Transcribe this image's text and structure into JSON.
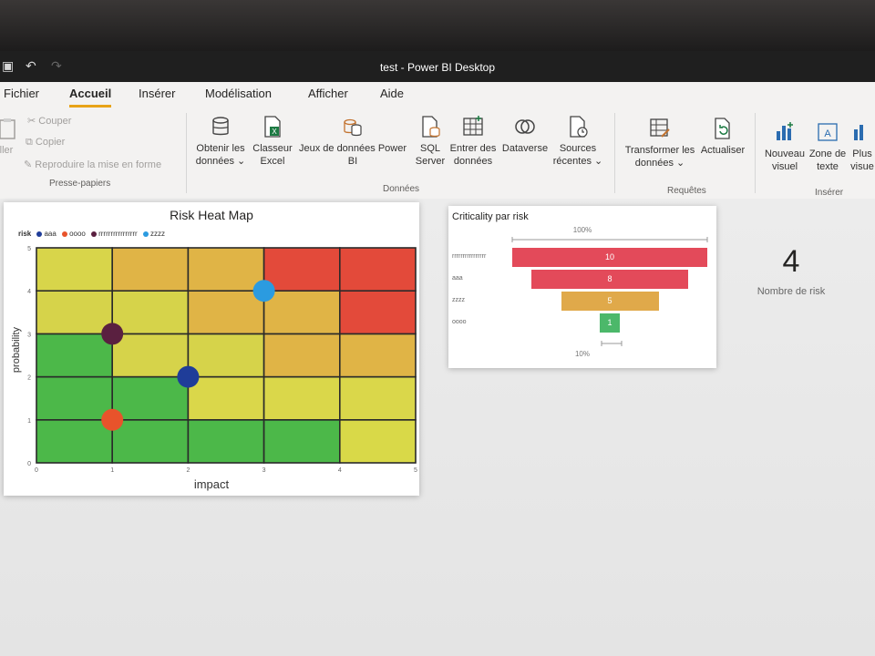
{
  "window": {
    "title": "test - Power BI Desktop",
    "save_icon": "save-icon",
    "undo_icon": "undo-icon",
    "redo_icon": "redo-icon"
  },
  "menu": {
    "items": [
      {
        "label": "Fichier"
      },
      {
        "label": "Accueil",
        "active": true
      },
      {
        "label": "Insérer"
      },
      {
        "label": "Modélisation"
      },
      {
        "label": "Afficher"
      },
      {
        "label": "Aide"
      }
    ]
  },
  "ribbon": {
    "clipboard": {
      "paste_label": "ller",
      "cut": "Couper",
      "copy": "Copier",
      "format_painter": "Reproduire la mise en forme",
      "group": "Presse-papiers"
    },
    "data": {
      "get_data": {
        "line1": "Obtenir les",
        "line2": "données"
      },
      "excel": {
        "line1": "Classeur",
        "line2": "Excel"
      },
      "datasets": {
        "line1": "Jeux de données Power",
        "line2": "BI"
      },
      "sql": {
        "line1": "SQL",
        "line2": "Server"
      },
      "enter_data": {
        "line1": "Entrer des",
        "line2": "données"
      },
      "dataverse": {
        "line1": "Dataverse"
      },
      "recent": {
        "line1": "Sources",
        "line2": "récentes"
      },
      "group": "Données"
    },
    "queries": {
      "transform": {
        "line1": "Transformer les",
        "line2": "données"
      },
      "refresh": {
        "line1": "Actualiser"
      },
      "group": "Requêtes"
    },
    "insert": {
      "new_visual": {
        "line1": "Nouveau",
        "line2": "visuel"
      },
      "text_box": {
        "line1": "Zone de",
        "line2": "texte"
      },
      "more": {
        "line1": "Plus",
        "line2": "visue"
      },
      "group": "Insérer"
    }
  },
  "heatmap": {
    "title": "Risk Heat Map",
    "legend_title": "risk",
    "legend_items": [
      {
        "label": "aaa",
        "color": "#1f3d99"
      },
      {
        "label": "oooo",
        "color": "#e8532b"
      },
      {
        "label": "rrrrrrrrrrrrrrrr",
        "color": "#5a2040"
      },
      {
        "label": "zzzz",
        "color": "#2b9be0"
      }
    ],
    "xlabel": "impact",
    "ylabel": "probability",
    "x_ticks": [
      "0",
      "1",
      "2",
      "3",
      "4",
      "5"
    ],
    "y_ticks": [
      "0",
      "1",
      "2",
      "3",
      "4",
      "5"
    ],
    "grid_colors": [
      [
        "#4cb849",
        "#4cb849",
        "#4cb849",
        "#4cb849",
        "#d9d948"
      ],
      [
        "#4cb849",
        "#4cb849",
        "#dad74a",
        "#dad74a",
        "#dad74a"
      ],
      [
        "#4cb849",
        "#d6d34a",
        "#d6d34a",
        "#e0b446",
        "#e0b446"
      ],
      [
        "#d6d34a",
        "#d6d34a",
        "#e0b446",
        "#e0b446",
        "#e34a3a"
      ],
      [
        "#d8d54a",
        "#e0b446",
        "#e0b446",
        "#e34a3a",
        "#e34a3a"
      ]
    ]
  },
  "chart_data": [
    {
      "type": "scatter",
      "title": "Risk Heat Map",
      "xlabel": "impact",
      "ylabel": "probability",
      "xlim": [
        0,
        5
      ],
      "ylim": [
        0,
        5
      ],
      "grid": true,
      "legend_placement": "top-left",
      "series": [
        {
          "name": "aaa",
          "color": "#1f3d99",
          "x": [
            2
          ],
          "y": [
            2
          ]
        },
        {
          "name": "oooo",
          "color": "#e8532b",
          "x": [
            1
          ],
          "y": [
            1
          ]
        },
        {
          "name": "rrrrrrrrrrrrrrrr",
          "color": "#5a2040",
          "x": [
            1
          ],
          "y": [
            3
          ]
        },
        {
          "name": "zzzz",
          "color": "#2b9be0",
          "x": [
            3
          ],
          "y": [
            4
          ]
        }
      ]
    },
    {
      "type": "bar",
      "title": "Criticality par risk",
      "categories": [
        "rrrrrrrrrrrrrrrr",
        "aaa",
        "zzzz",
        "oooo"
      ],
      "values": [
        10,
        8,
        5,
        1
      ],
      "colors": [
        "#e34a5a",
        "#e34a5a",
        "#e0a94a",
        "#4cb86a"
      ],
      "top_pct_label": "100%",
      "bottom_pct_label": "10%"
    }
  ],
  "kpi": {
    "value": "4",
    "label": "Nombre de risk"
  }
}
